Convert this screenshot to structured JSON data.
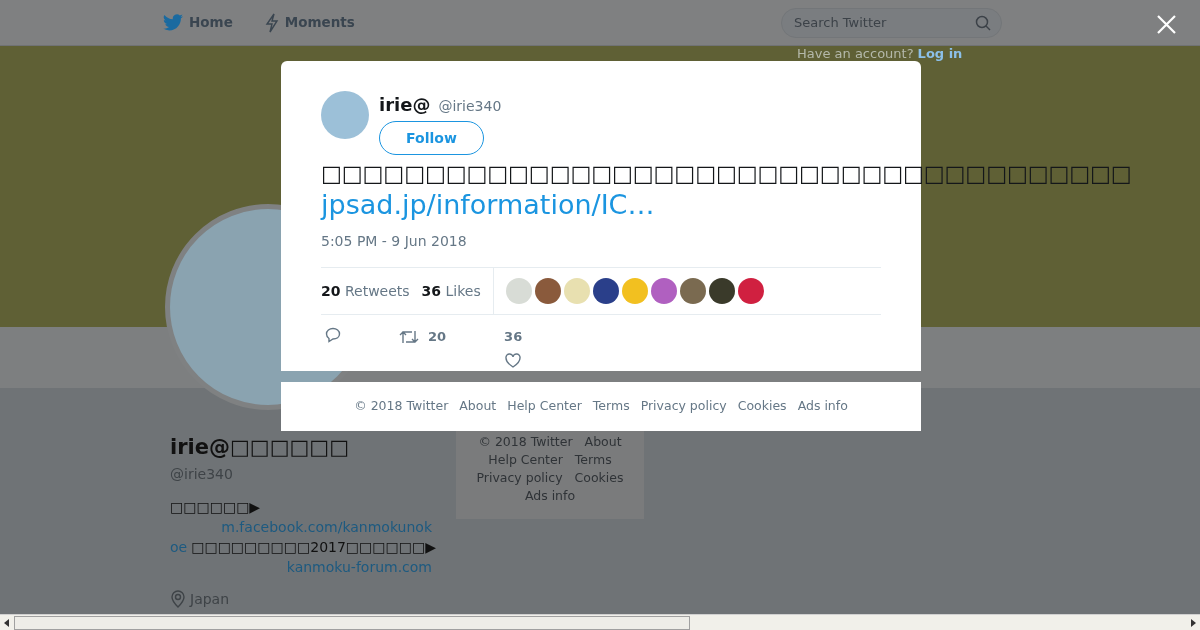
{
  "nav": {
    "items": [
      {
        "label": "Home",
        "kind": "bird"
      },
      {
        "label": "Moments",
        "kind": "bolt"
      }
    ],
    "search": {
      "placeholder": "Search Twitter"
    },
    "account": {
      "prompt": "Have an account?",
      "login": "Log in"
    }
  },
  "profile": {
    "name": "irie@□□□□□□",
    "handle": "@irie340",
    "bio": [
      {
        "kind": "text",
        "text": "□□□□□□▶"
      },
      {
        "kind": "link",
        "text": "m.facebook.com/kanmokunok"
      },
      {
        "kind": "link",
        "text": "oe"
      },
      {
        "kind": "text",
        "text": "□□□□□□□□□2017□□□□□□▶"
      },
      {
        "kind": "link",
        "text": "kanmoku-forum.com"
      }
    ],
    "location": "Japan"
  },
  "side_footer": [
    "© 2018 Twitter",
    "About",
    "Help Center",
    "Terms",
    "Privacy policy",
    "Cookies",
    "Ads info"
  ],
  "tweet": {
    "name": "irie@",
    "handle": "@irie340",
    "follow": "Follow",
    "text": "□□□□□□□□□□□□□□□□□□□□□□□□□□□□□□□□□□□□□□□",
    "link": "jpsad.jp/information/IC…",
    "time": "5:05 PM - 9 Jun 2018",
    "stats": [
      {
        "count": "20",
        "label": "Retweets"
      },
      {
        "count": "36",
        "label": "Likes"
      }
    ],
    "likers": [
      {
        "color": "#d8dcd6"
      },
      {
        "color": "#8a5a3c"
      },
      {
        "color": "#e8e0b0"
      },
      {
        "color": "#2a3f8a"
      },
      {
        "color": "#f2c020"
      },
      {
        "color": "#b060c0"
      },
      {
        "color": "#7a6a50"
      },
      {
        "color": "#3a3a2a"
      },
      {
        "color": "#d02040"
      }
    ],
    "actions": [
      {
        "kind": "reply"
      },
      {
        "kind": "retweet",
        "count": "20"
      },
      {
        "kind": "like",
        "count": "36"
      }
    ]
  },
  "footer": [
    "© 2018 Twitter",
    "About",
    "Help Center",
    "Terms",
    "Privacy policy",
    "Cookies",
    "Ads info"
  ]
}
